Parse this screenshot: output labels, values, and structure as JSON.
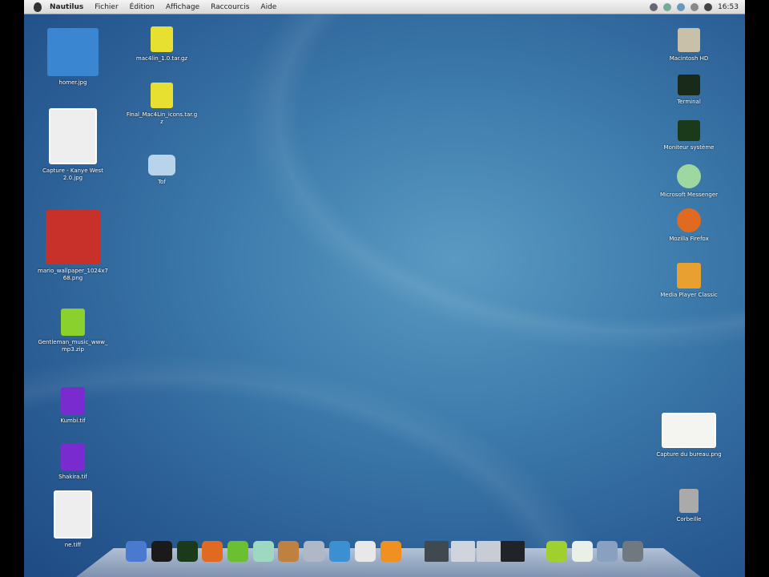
{
  "menubar": {
    "app": "Nautilus",
    "items": [
      "Fichier",
      "Édition",
      "Affichage",
      "Raccourcis",
      "Aide"
    ],
    "clock": "16:53"
  },
  "left_icons": [
    {
      "label": "homer.jpg",
      "kind": "image-homer",
      "color": "#3a86d0"
    },
    {
      "label": "Capture - Kanye West 2.0.jpg",
      "kind": "photo",
      "color": "#eee"
    },
    {
      "label": "mario_wallpaper_1024x768.png",
      "kind": "image-mario",
      "color": "#c8302a"
    },
    {
      "label": "Gentleman_music_www_mp3.zip",
      "kind": "archive",
      "color": "#8ad12e"
    },
    {
      "label": "Kumbi.tif",
      "kind": "image-purple",
      "color": "#7a2bd0"
    },
    {
      "label": "Shakira.tif",
      "kind": "image-purple",
      "color": "#7a2bd0"
    },
    {
      "label": "ne.tiff",
      "kind": "photo",
      "color": "#eee"
    }
  ],
  "mid_icons": [
    {
      "label": "mac4lin_1.0.tar.gz",
      "kind": "archive",
      "color": "#e8e030"
    },
    {
      "label": "Final_Mac4Lin_icons.tar.gz",
      "kind": "archive",
      "color": "#e8e030"
    },
    {
      "label": "Tof",
      "kind": "folder",
      "color": "#b8d4ea"
    }
  ],
  "right_icons": [
    {
      "label": "Macintosh HD",
      "kind": "drive",
      "color": "#c8c0a8"
    },
    {
      "label": "Terminal",
      "kind": "terminal",
      "color": "#1a2a1a"
    },
    {
      "label": "Moniteur système",
      "kind": "monitor",
      "color": "#1a3a1a"
    },
    {
      "label": "Microsoft Messenger",
      "kind": "messenger",
      "color": "#9ed8a0"
    },
    {
      "label": "Mozilla Firefox",
      "kind": "firefox",
      "color": "#e06a20"
    },
    {
      "label": "Media Player Classic",
      "kind": "player",
      "color": "#e8a030"
    },
    {
      "label": "Capture du bureau.png",
      "kind": "screenshot",
      "color": "#f4f4f0"
    },
    {
      "label": "Corbeille",
      "kind": "trash",
      "color": "#aaa"
    }
  ],
  "dock": [
    {
      "name": "finder",
      "color": "#4a7ad0"
    },
    {
      "name": "terminal",
      "color": "#1a1a1a"
    },
    {
      "name": "monitor",
      "color": "#1a3a1a"
    },
    {
      "name": "firefox",
      "color": "#e06a20"
    },
    {
      "name": "android",
      "color": "#6ac030"
    },
    {
      "name": "messenger",
      "color": "#9ed8c0"
    },
    {
      "name": "gimp",
      "color": "#c08040"
    },
    {
      "name": "pidgin",
      "color": "#b0b8c8"
    },
    {
      "name": "skype",
      "color": "#3a90d0"
    },
    {
      "name": "mail",
      "color": "#e8e8e8"
    },
    {
      "name": "vlc",
      "color": "#f09020"
    },
    {
      "name": "window1",
      "color": "#404850"
    },
    {
      "name": "window2",
      "color": "#d0d4dc"
    },
    {
      "name": "window3",
      "color": "#c8ccd4"
    },
    {
      "name": "window4",
      "color": "#202428"
    },
    {
      "name": "android2",
      "color": "#a0d030"
    },
    {
      "name": "cd",
      "color": "#e8f0e8"
    },
    {
      "name": "downloads",
      "color": "#8aa0c0"
    },
    {
      "name": "trash",
      "color": "#707880"
    }
  ]
}
